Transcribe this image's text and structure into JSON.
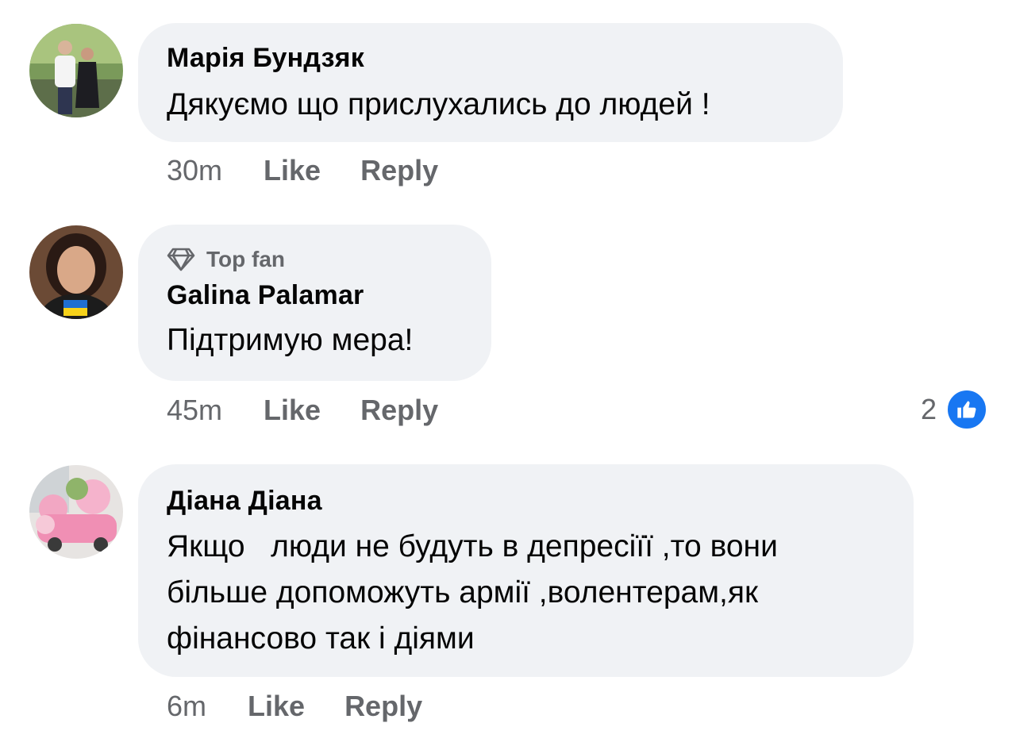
{
  "comments": [
    {
      "author": "Марія Бундзяк",
      "text": "Дякуємо що прислухались до людей !",
      "time": "30m",
      "like_label": "Like",
      "reply_label": "Reply"
    },
    {
      "badge_label": "Top fan",
      "badge_icon": "diamond-icon",
      "author": "Galina Palamar",
      "text": "Підтримую мера!",
      "time": "45m",
      "like_label": "Like",
      "reply_label": "Reply",
      "reaction_count": "2",
      "reaction_icon": "thumbs-up-icon"
    },
    {
      "author": "Діана Діана",
      "text": "Якщо   люди не будуть в депресіїї ,то вони більше допоможуть армії ,волентерам,як фінансово так і діями",
      "time": "6m",
      "like_label": "Like",
      "reply_label": "Reply"
    }
  ],
  "colors": {
    "bubble": "#f0f2f5",
    "meta_text": "#65676b",
    "like_blue": "#1877f2"
  }
}
